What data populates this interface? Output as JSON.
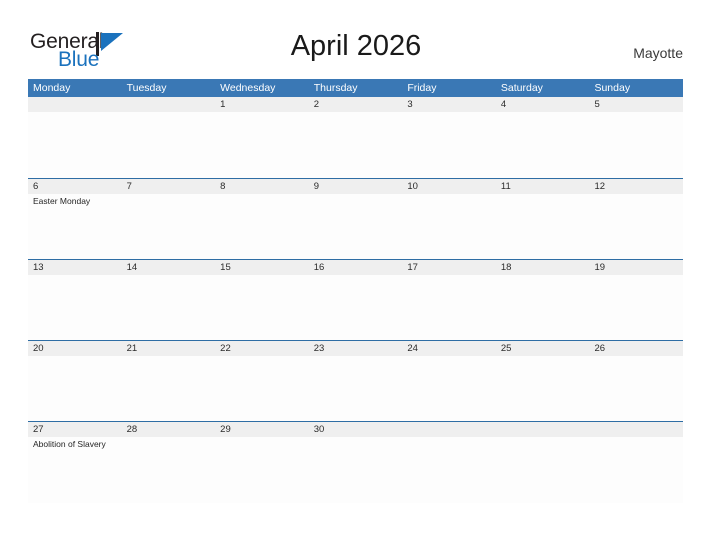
{
  "brand": {
    "line1": "General",
    "line2": "Blue",
    "mark_icon": "blue-triangle-flag-icon",
    "mark_color": "#1b72bd"
  },
  "header": {
    "title": "April 2026",
    "locale": "Mayotte"
  },
  "colors": {
    "header_blue": "#3a78b5",
    "row_line_blue": "#2e6da4",
    "strip_gray": "#efefef",
    "brand_blue": "#1b72bd"
  },
  "calendar": {
    "weekdays": [
      "Monday",
      "Tuesday",
      "Wednesday",
      "Thursday",
      "Friday",
      "Saturday",
      "Sunday"
    ],
    "weeks": [
      {
        "days": [
          {
            "number": "",
            "events": []
          },
          {
            "number": "",
            "events": []
          },
          {
            "number": "1",
            "events": []
          },
          {
            "number": "2",
            "events": []
          },
          {
            "number": "3",
            "events": []
          },
          {
            "number": "4",
            "events": []
          },
          {
            "number": "5",
            "events": []
          }
        ]
      },
      {
        "days": [
          {
            "number": "6",
            "events": [
              "Easter Monday"
            ]
          },
          {
            "number": "7",
            "events": []
          },
          {
            "number": "8",
            "events": []
          },
          {
            "number": "9",
            "events": []
          },
          {
            "number": "10",
            "events": []
          },
          {
            "number": "11",
            "events": []
          },
          {
            "number": "12",
            "events": []
          }
        ]
      },
      {
        "days": [
          {
            "number": "13",
            "events": []
          },
          {
            "number": "14",
            "events": []
          },
          {
            "number": "15",
            "events": []
          },
          {
            "number": "16",
            "events": []
          },
          {
            "number": "17",
            "events": []
          },
          {
            "number": "18",
            "events": []
          },
          {
            "number": "19",
            "events": []
          }
        ]
      },
      {
        "days": [
          {
            "number": "20",
            "events": []
          },
          {
            "number": "21",
            "events": []
          },
          {
            "number": "22",
            "events": []
          },
          {
            "number": "23",
            "events": []
          },
          {
            "number": "24",
            "events": []
          },
          {
            "number": "25",
            "events": []
          },
          {
            "number": "26",
            "events": []
          }
        ]
      },
      {
        "days": [
          {
            "number": "27",
            "events": [
              "Abolition of Slavery"
            ]
          },
          {
            "number": "28",
            "events": []
          },
          {
            "number": "29",
            "events": []
          },
          {
            "number": "30",
            "events": []
          },
          {
            "number": "",
            "events": []
          },
          {
            "number": "",
            "events": []
          },
          {
            "number": "",
            "events": []
          }
        ]
      }
    ]
  }
}
